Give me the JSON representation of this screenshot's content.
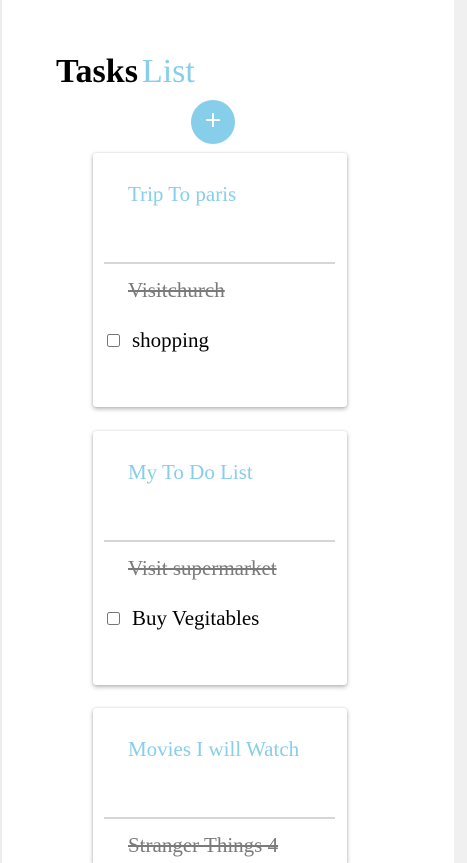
{
  "header": {
    "title_strong": "Tasks",
    "title_light": "List"
  },
  "add_button": {
    "label": "+"
  },
  "lists": [
    {
      "title": "Trip To paris",
      "completed": [
        "Visitchurch"
      ],
      "pending": [
        "shopping"
      ]
    },
    {
      "title": "My To Do List",
      "completed": [
        "Visit supermarket"
      ],
      "pending": [
        "Buy Vegitables"
      ]
    },
    {
      "title": "Movies I will Watch",
      "completed": [
        "Stranger Things 4"
      ],
      "pending": []
    }
  ],
  "colors": {
    "accent": "#87ceeb",
    "card_background": "#ffffff",
    "completed_text": "#7a7a7a",
    "divider": "#d6d6d6"
  },
  "icons": {
    "add": "plus-icon",
    "checkbox": "checkbox-icon"
  }
}
